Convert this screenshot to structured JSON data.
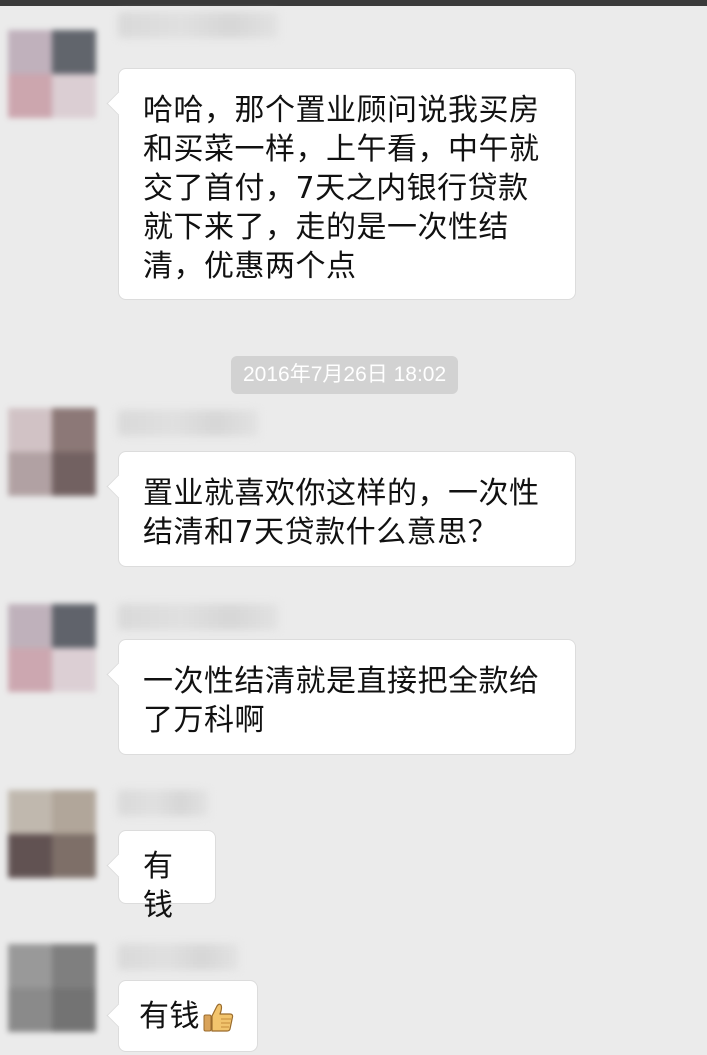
{
  "chat": {
    "messages": [
      {
        "text": "哈哈，那个置业顾问说我买房和买菜一样，上午看，中午就交了首付，7天之内银行贷款就下来了，走的是一次性结清，优惠两个点"
      },
      {
        "text": "置业就喜欢你这样的，一次性结清和7天贷款什么意思？"
      },
      {
        "text": "一次性结清就是直接把全款给了万科啊"
      },
      {
        "text": "有钱"
      },
      {
        "text": "有钱",
        "emoji": "thumbs-up-icon"
      }
    ],
    "timestamp": "2016年7月26日 18:02"
  },
  "colors": {
    "background": "#ebebeb",
    "bubble": "#ffffff",
    "timestamp_bg": "#d2d2d2"
  }
}
